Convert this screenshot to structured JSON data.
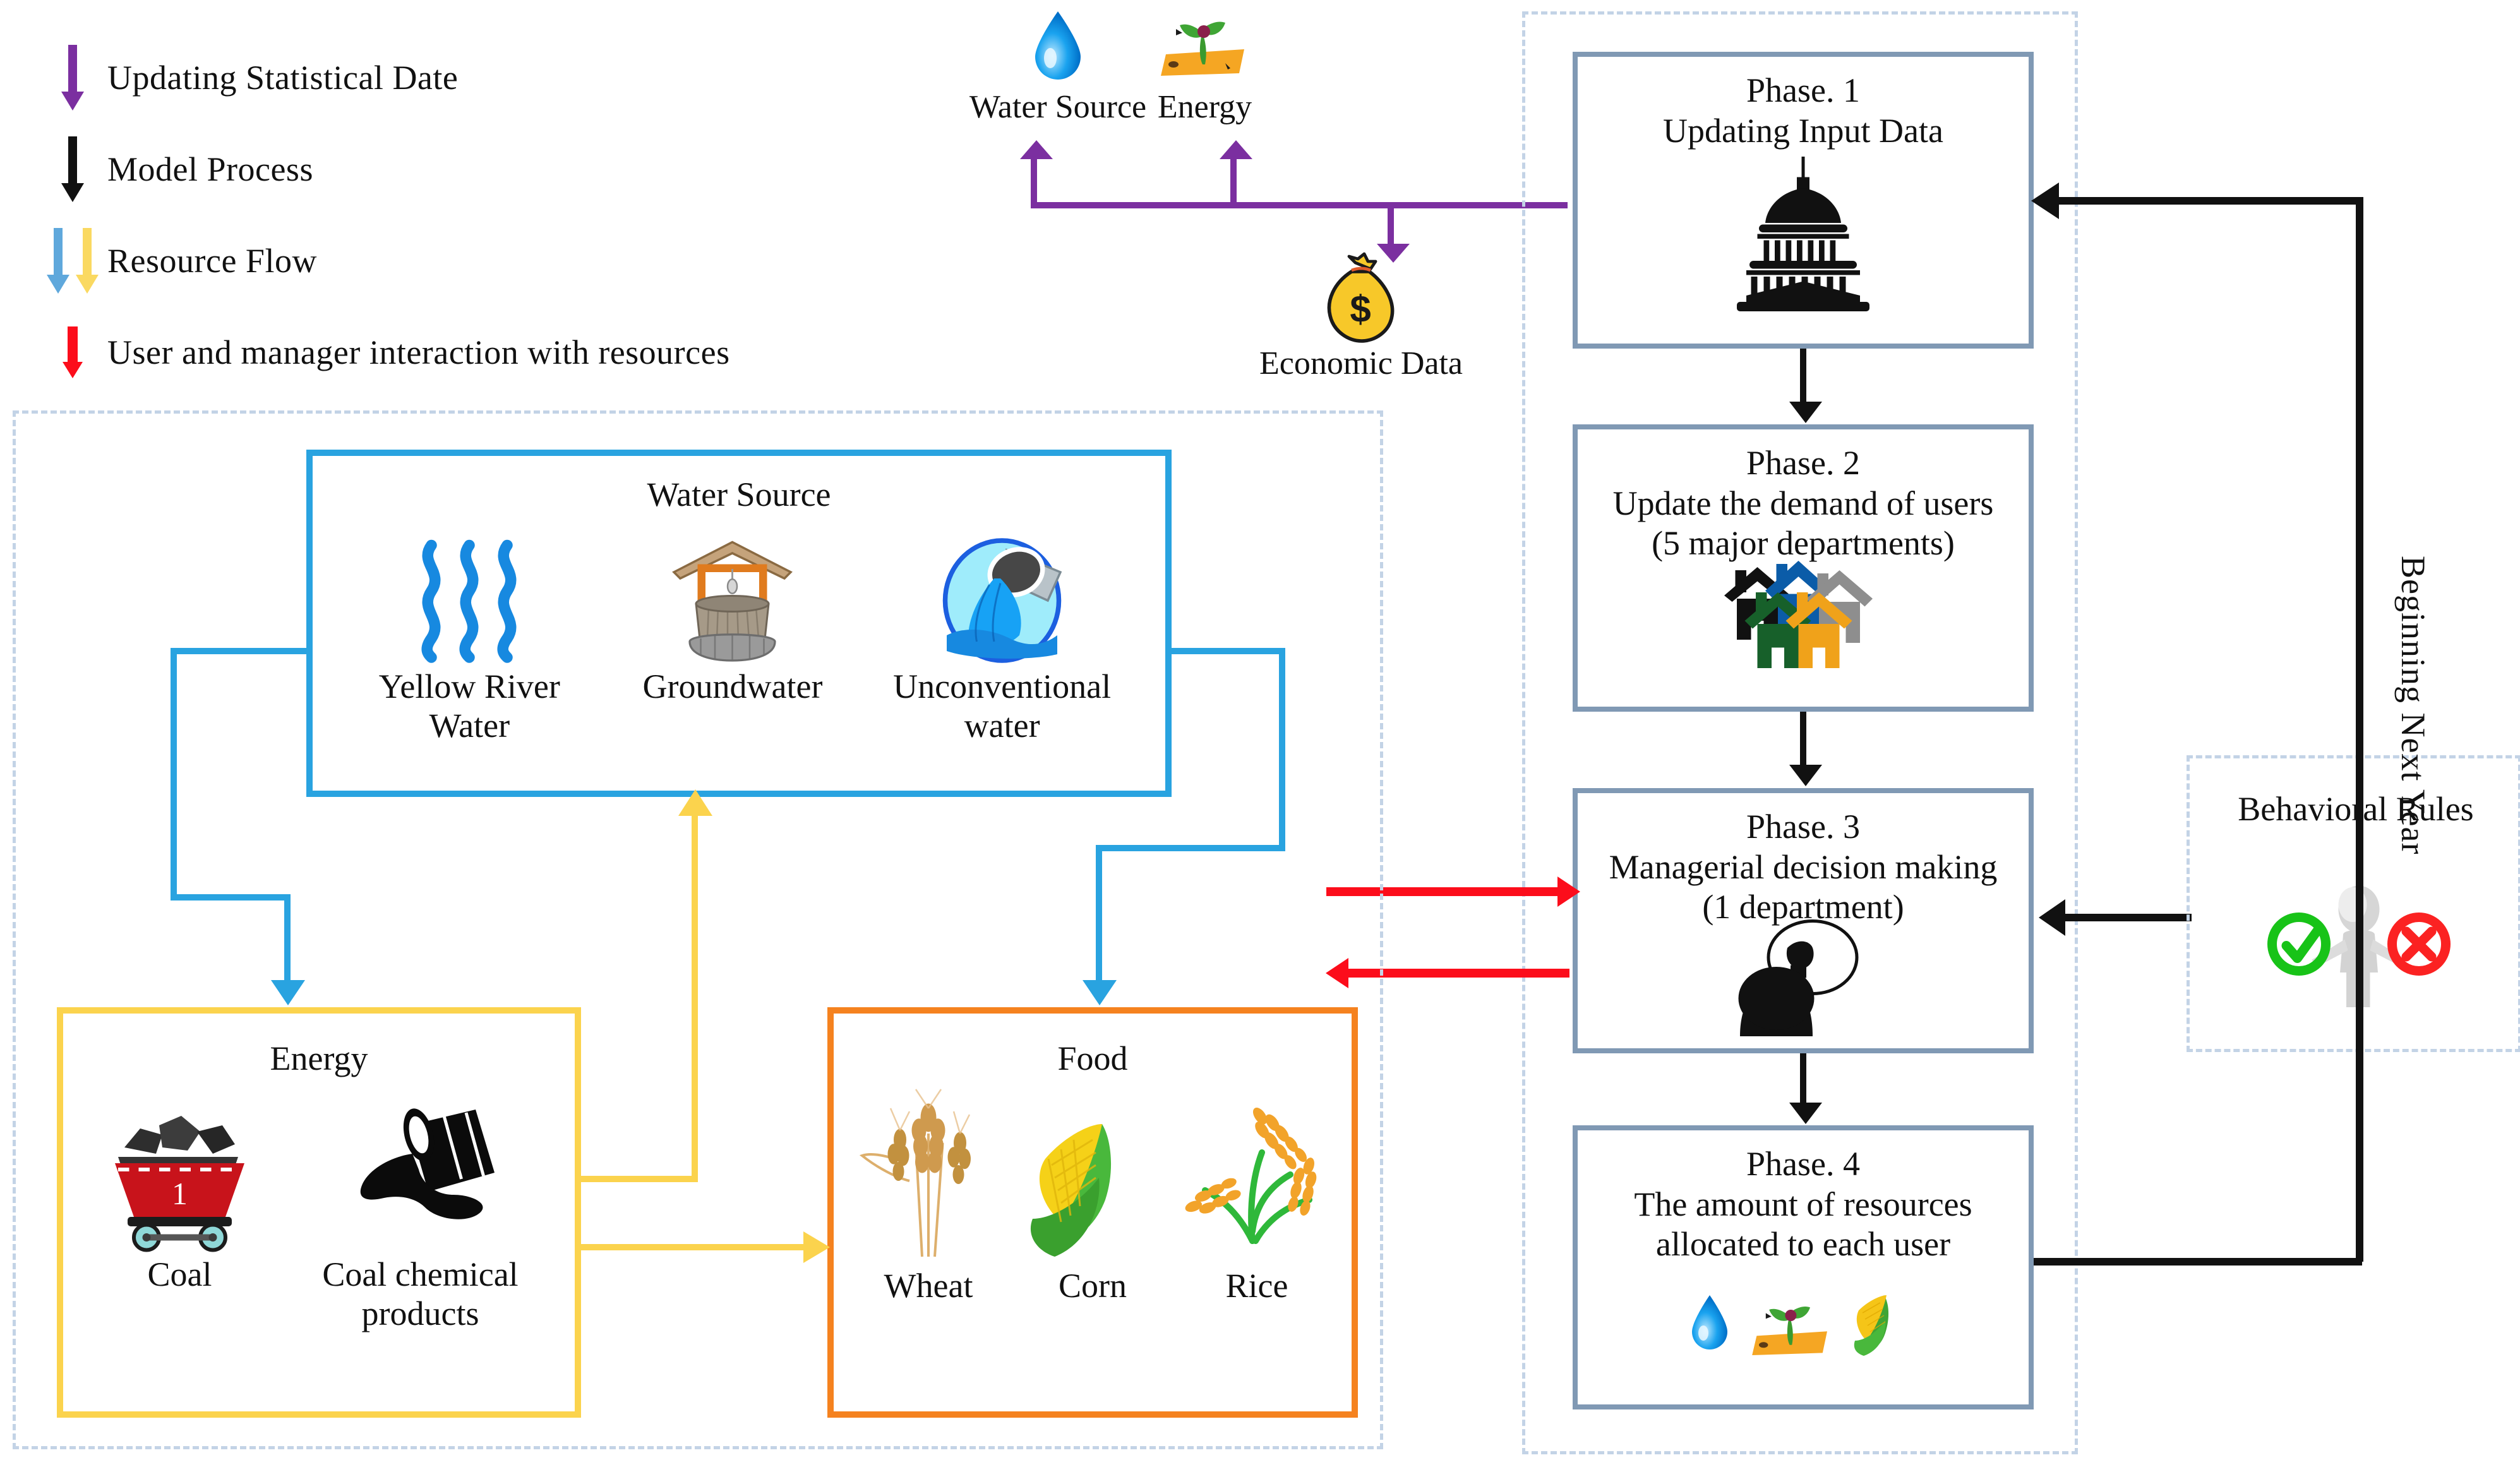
{
  "legend": {
    "items": [
      {
        "label": "Updating Statistical Date",
        "colors": [
          "#7b2fa0"
        ],
        "icon": "down-arrow-purple"
      },
      {
        "label": "Model Process",
        "colors": [
          "#111111"
        ],
        "icon": "down-arrow-black"
      },
      {
        "label": "Resource Flow",
        "colors": [
          "#5fa8dc",
          "#fad961"
        ],
        "icon": "down-arrow-blue-yellow"
      },
      {
        "label": "User and manager interaction with resources",
        "colors": [
          "#fc0d1b"
        ],
        "icon": "down-arrow-red"
      }
    ]
  },
  "top_resources": {
    "water_source": {
      "label": "Water Source",
      "icon": "water-drop-icon"
    },
    "energy": {
      "label": "Energy",
      "icon": "energy-field-icon"
    },
    "economic_data": {
      "label": "Economic Data",
      "icon": "money-bag-icon"
    }
  },
  "resource_panel": {
    "water": {
      "title": "Water Source",
      "border_color": "#29a3e0",
      "items": [
        {
          "label": "Yellow River Water",
          "icon": "river-waves-icon"
        },
        {
          "label": "Groundwater",
          "icon": "well-icon"
        },
        {
          "label": "Unconventional water",
          "icon": "pipe-outflow-icon"
        }
      ]
    },
    "energy": {
      "title": "Energy",
      "border_color": "#fbd34d",
      "items": [
        {
          "label": "Coal",
          "icon": "coal-cart-icon"
        },
        {
          "label": "Coal chemical products",
          "icon": "oil-barrel-icon"
        }
      ]
    },
    "food": {
      "title": "Food",
      "border_color": "#f5821f",
      "items": [
        {
          "label": "Wheat",
          "icon": "wheat-icon"
        },
        {
          "label": "Corn",
          "icon": "corn-icon"
        },
        {
          "label": "Rice",
          "icon": "rice-icon"
        }
      ]
    }
  },
  "phases": [
    {
      "title": "Phase. 1",
      "line2": "Updating Input Data",
      "line3": "",
      "icon": "government-building-icon"
    },
    {
      "title": "Phase. 2",
      "line2": "Update the demand of users",
      "line3": "(5 major departments)",
      "icon": "five-houses-icon"
    },
    {
      "title": "Phase. 3",
      "line2": "Managerial decision making",
      "line3": "(1 department)",
      "icon": "thinking-person-icon"
    },
    {
      "title": "Phase. 4",
      "line2": "The amount of resources",
      "line3": "allocated to each user",
      "icon": "water-energy-food-icon"
    }
  ],
  "behavioral_rules": {
    "title": "Behavioral Rules",
    "icon": "person-check-cross-icon",
    "check_color": "#18c318",
    "cross_color": "#fb2222"
  },
  "loop_label": "Beginning Next Year",
  "colors": {
    "purple": "#7b2fa0",
    "black": "#111111",
    "blue": "#29a3e0",
    "yellow": "#fbd34d",
    "red": "#fc0d1b",
    "orange": "#f5821f",
    "phase_border": "#8099b4",
    "dotted": "#c3d3e6"
  }
}
